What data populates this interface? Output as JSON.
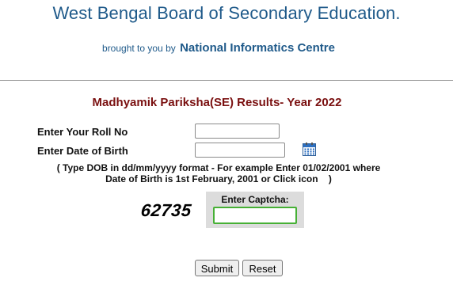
{
  "header": {
    "title": "West Bengal Board of Secondary Education.",
    "credit_prefix": "brought to you by",
    "credit_org": "National Informatics Centre"
  },
  "form": {
    "title": "Madhyamik Pariksha(SE) Results- Year 2022",
    "roll_label": "Enter Your Roll No",
    "roll_value": "",
    "dob_label": "Enter Date of Birth",
    "dob_value": "",
    "dob_icon": "calendar-icon",
    "hint_line1": "( Type DOB in dd/mm/yyyy format - For example Enter 01/02/2001 where",
    "hint_line2": "Date of Birth is 1st February, 2001 or Click icon    )",
    "captcha_code": "62735",
    "captcha_label": "Enter Captcha:",
    "captcha_value": "",
    "submit_label": "Submit",
    "reset_label": "Reset"
  },
  "colors": {
    "title_blue": "#1f5a8a",
    "exam_title_red": "#7a1010",
    "captcha_focus_green": "#46b035",
    "captcha_panel": "#dcdcdc"
  }
}
